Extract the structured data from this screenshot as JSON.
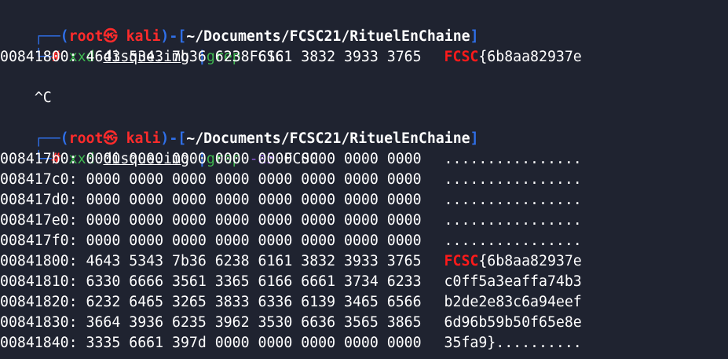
{
  "prompt1": {
    "box_top_left": "┌──(",
    "user": "root",
    "skull": "㉿",
    "host": " kali",
    "box_mid": ")-[",
    "path": "~/Documents/FCSC21/RituelEnChaine",
    "box_close": "]",
    "box_bottom": "└─",
    "hash": "#",
    "cmd": "xxd",
    "arg": "disque.img",
    "pipe": "|",
    "cmd2": "grep",
    "opt": "",
    "pattern": " FCSC"
  },
  "output1": {
    "hex": "00841800: 4643 5343 7b36 6238 6161 3832 3933 3765",
    "ascii_hl": "FCSC",
    "ascii_rest": "{6b8aa82937e"
  },
  "interrupt": "^C",
  "prompt2": {
    "box_top_left": "┌──(",
    "user": "root",
    "skull": "㉿",
    "host": " kali",
    "box_mid": ")-[",
    "path": "~/Documents/FCSC21/RituelEnChaine",
    "box_close": "]",
    "box_bottom": "└─",
    "hash": "#",
    "cmd": "xxd",
    "arg": "disque.img",
    "pipe": "|",
    "cmd2": "grep",
    "opt": " -a5",
    "pattern": " FCSC"
  },
  "output2": [
    {
      "hex": "008417b0: 0000 0000 0000 0000 0000 0000 0000 0000",
      "ascii_hl": "",
      "ascii_rest": "................"
    },
    {
      "hex": "008417c0: 0000 0000 0000 0000 0000 0000 0000 0000",
      "ascii_hl": "",
      "ascii_rest": "................"
    },
    {
      "hex": "008417d0: 0000 0000 0000 0000 0000 0000 0000 0000",
      "ascii_hl": "",
      "ascii_rest": "................"
    },
    {
      "hex": "008417e0: 0000 0000 0000 0000 0000 0000 0000 0000",
      "ascii_hl": "",
      "ascii_rest": "................"
    },
    {
      "hex": "008417f0: 0000 0000 0000 0000 0000 0000 0000 0000",
      "ascii_hl": "",
      "ascii_rest": "................"
    },
    {
      "hex": "00841800: 4643 5343 7b36 6238 6161 3832 3933 3765",
      "ascii_hl": "FCSC",
      "ascii_rest": "{6b8aa82937e"
    },
    {
      "hex": "00841810: 6330 6666 3561 3365 6166 6661 3734 6233",
      "ascii_hl": "",
      "ascii_rest": "c0ff5a3eaffa74b3"
    },
    {
      "hex": "00841820: 6232 6465 3265 3833 6336 6139 3465 6566",
      "ascii_hl": "",
      "ascii_rest": "b2de2e83c6a94eef"
    },
    {
      "hex": "00841830: 3664 3936 6235 3962 3530 6636 3565 3865",
      "ascii_hl": "",
      "ascii_rest": "6d96b59b50f65e8e"
    },
    {
      "hex": "00841840: 3335 6661 397d 0000 0000 0000 0000 0000",
      "ascii_hl": "",
      "ascii_rest": "35fa9}.........."
    }
  ]
}
